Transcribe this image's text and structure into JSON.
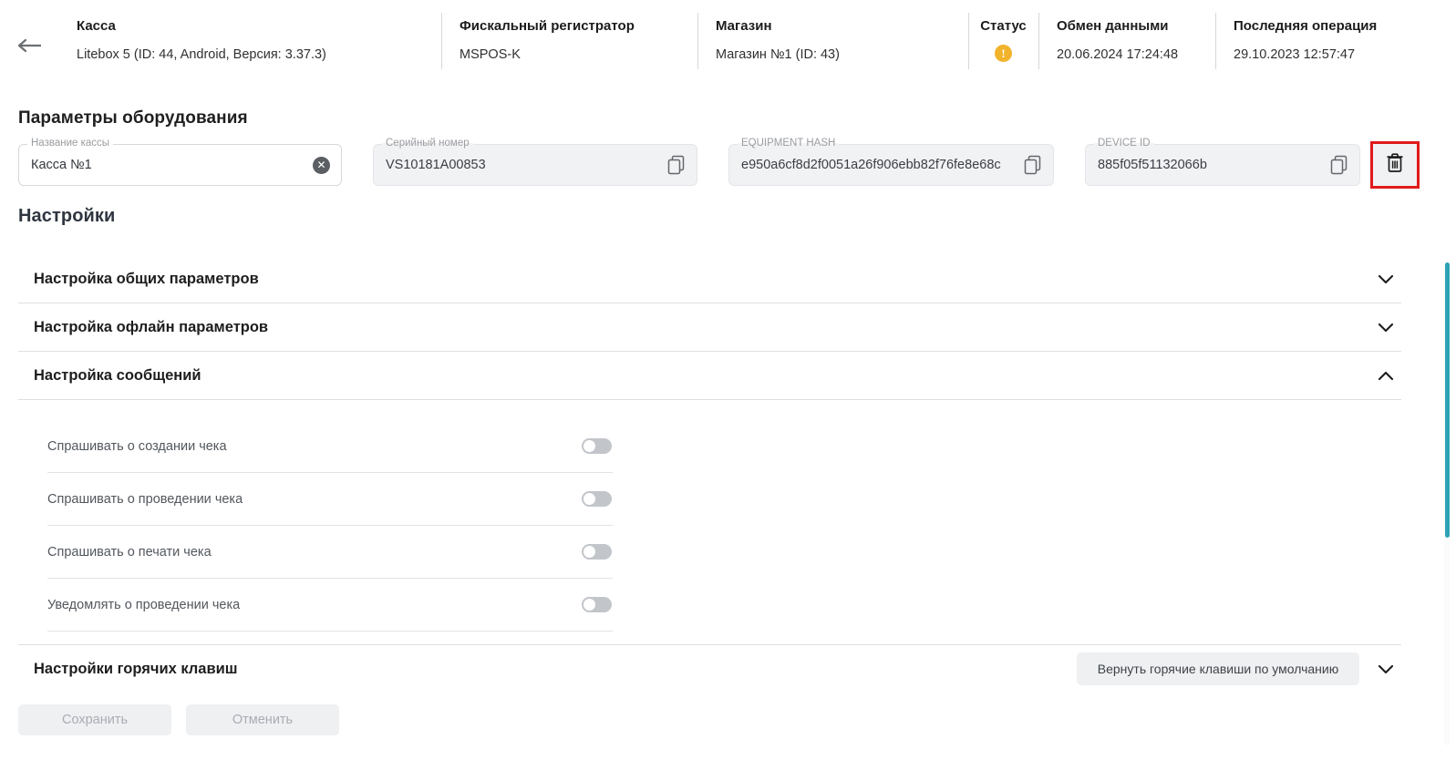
{
  "header": {
    "back_icon": "arrow-left-icon",
    "cells": [
      {
        "label": "Касса",
        "value": "Litebox 5 (ID: 44, Android, Версия: 3.37.3)"
      },
      {
        "label": "Фискальный регистратор",
        "value": "MSPOS-K"
      },
      {
        "label": "Магазин",
        "value": "Магазин №1 (ID: 43)"
      },
      {
        "label": "Статус",
        "value": "",
        "icon": "warning-icon",
        "icon_color": "#f2b32c"
      },
      {
        "label": "Обмен данными",
        "value": "20.06.2024 17:24:48"
      },
      {
        "label": "Последняя операция",
        "value": "29.10.2023 12:57:47"
      }
    ]
  },
  "equipment": {
    "title": "Параметры оборудования",
    "fields": [
      {
        "legend": "Название кассы",
        "value": "Касса №1",
        "action_icon": "clear-icon",
        "readonly": false
      },
      {
        "legend": "Серийный номер",
        "value": "VS10181A00853",
        "action_icon": "copy-icon",
        "readonly": true
      },
      {
        "legend": "EQUIPMENT HASH",
        "value": "e950a6cf8d2f0051a26f906ebb82f76fe8e68c",
        "action_icon": "copy-icon",
        "readonly": true
      },
      {
        "legend": "DEVICE ID",
        "value": "885f05f51132066b",
        "action_icon": "copy-icon",
        "readonly": true
      }
    ],
    "delete_button": {
      "icon": "trash-icon",
      "highlight_color": "#e01b1b"
    }
  },
  "settings": {
    "title": "Настройки",
    "sections": [
      {
        "label": "Настройка общих параметров",
        "expanded": false,
        "chevron": "chevron-down-icon"
      },
      {
        "label": "Настройка офлайн параметров",
        "expanded": false,
        "chevron": "chevron-down-icon"
      },
      {
        "label": "Настройка сообщений",
        "expanded": true,
        "chevron": "chevron-up-icon"
      }
    ],
    "messages_toggles": [
      {
        "label": "Спрашивать о создании чека",
        "on": false
      },
      {
        "label": "Спрашивать о проведении чека",
        "on": false
      },
      {
        "label": "Спрашивать о печати чека",
        "on": false
      },
      {
        "label": "Уведомлять о проведении чека",
        "on": false
      }
    ],
    "hotkeys": {
      "label": "Настройки горячих клавиш",
      "reset_button": "Вернуть горячие клавиши по умолчанию",
      "chevron": "chevron-down-icon"
    }
  },
  "footer": {
    "save_label": "Сохранить",
    "cancel_label": "Отменить",
    "save_disabled": true,
    "cancel_disabled": true
  },
  "scrollbar": {
    "thumb_color": "#2ea3b5"
  }
}
